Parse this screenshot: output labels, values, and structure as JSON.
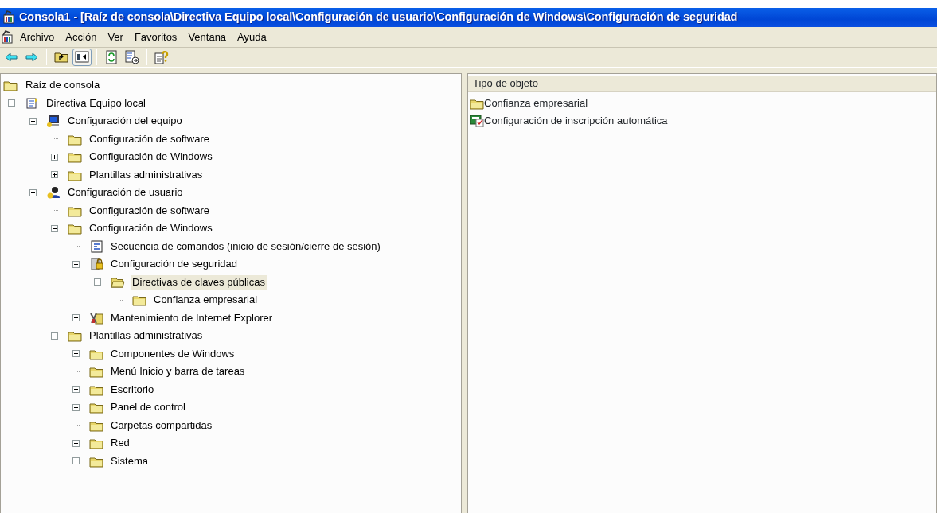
{
  "window": {
    "title": "Consola1 - [Raíz de consola\\Directiva Equipo local\\Configuración de usuario\\Configuración de Windows\\Configuración de seguridad"
  },
  "menu": [
    "Archivo",
    "Acción",
    "Ver",
    "Favoritos",
    "Ventana",
    "Ayuda"
  ],
  "toolbar": [
    {
      "kind": "back",
      "pressed": false
    },
    {
      "kind": "forward",
      "pressed": false
    },
    {
      "kind": "separator"
    },
    {
      "kind": "up",
      "pressed": false
    },
    {
      "kind": "tree",
      "pressed": true
    },
    {
      "kind": "separator"
    },
    {
      "kind": "refresh",
      "pressed": false
    },
    {
      "kind": "export",
      "pressed": false
    },
    {
      "kind": "separator"
    },
    {
      "kind": "help",
      "pressed": false
    }
  ],
  "tree": [
    {
      "label": "Raíz de consola",
      "kind": "folder",
      "selected": false,
      "children": [
        {
          "label": "Directiva Equipo local",
          "kind": "policy",
          "expanded": true,
          "selected": false,
          "children": [
            {
              "label": "Configuración del equipo",
              "kind": "computer",
              "expanded": true,
              "selected": false,
              "children": [
                {
                  "label": "Configuración de software",
                  "kind": "folder",
                  "selected": false
                },
                {
                  "label": "Configuración de Windows",
                  "kind": "folder",
                  "expanded": false,
                  "selected": false
                },
                {
                  "label": "Plantillas administrativas",
                  "kind": "folder",
                  "expanded": false,
                  "selected": false
                }
              ]
            },
            {
              "label": "Configuración de usuario",
              "kind": "user",
              "expanded": true,
              "selected": false,
              "children": [
                {
                  "label": "Configuración de software",
                  "kind": "folder",
                  "selected": false
                },
                {
                  "label": "Configuración de Windows",
                  "kind": "folder",
                  "expanded": true,
                  "selected": false,
                  "children": [
                    {
                      "label": "Secuencia de comandos (inicio de sesión/cierre de sesión)",
                      "kind": "script",
                      "selected": false
                    },
                    {
                      "label": "Configuración de seguridad",
                      "kind": "security",
                      "expanded": true,
                      "selected": false,
                      "children": [
                        {
                          "label": "Directivas de claves públicas",
                          "kind": "folder-open",
                          "expanded": true,
                          "selected": true,
                          "children": [
                            {
                              "label": "Confianza empresarial",
                              "kind": "folder",
                              "selected": false
                            }
                          ]
                        }
                      ]
                    },
                    {
                      "label": "Mantenimiento de Internet Explorer",
                      "kind": "ie",
                      "expanded": false,
                      "selected": false
                    }
                  ]
                },
                {
                  "label": "Plantillas administrativas",
                  "kind": "folder",
                  "expanded": true,
                  "selected": false,
                  "children": [
                    {
                      "label": "Componentes de Windows",
                      "kind": "folder",
                      "expanded": false,
                      "selected": false
                    },
                    {
                      "label": "Menú Inicio y barra de tareas",
                      "kind": "folder",
                      "selected": false
                    },
                    {
                      "label": "Escritorio",
                      "kind": "folder",
                      "expanded": false,
                      "selected": false
                    },
                    {
                      "label": "Panel de control",
                      "kind": "folder",
                      "expanded": false,
                      "selected": false
                    },
                    {
                      "label": "Carpetas compartidas",
                      "kind": "folder",
                      "selected": false
                    },
                    {
                      "label": "Red",
                      "kind": "folder",
                      "expanded": false,
                      "selected": false
                    },
                    {
                      "label": "Sistema",
                      "kind": "folder",
                      "expanded": false,
                      "selected": false
                    }
                  ]
                }
              ]
            }
          ]
        }
      ]
    }
  ],
  "list": {
    "columns": [
      "Tipo de objeto"
    ],
    "rows": [
      {
        "label": "Confianza empresarial",
        "kind": "folder"
      },
      {
        "label": "Configuración de inscripción automática",
        "kind": "settings"
      }
    ]
  }
}
